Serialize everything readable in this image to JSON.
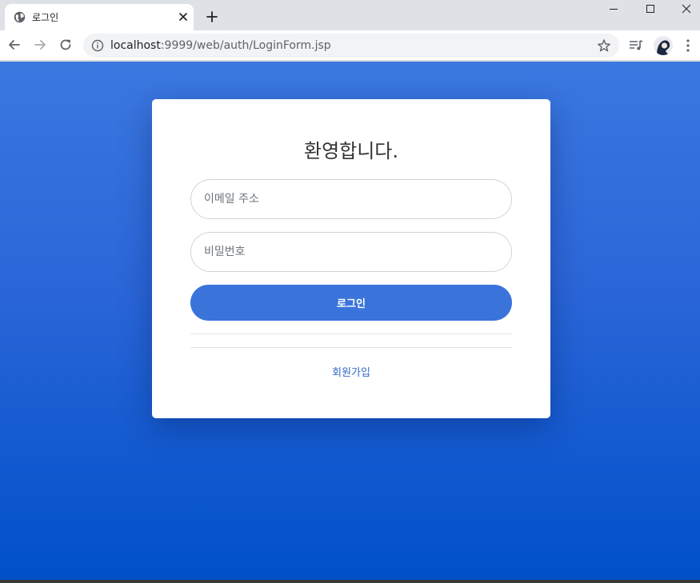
{
  "browser": {
    "tab_title": "로그인",
    "url_host": "localhost",
    "url_rest": ":9999/web/auth/LoginForm.jsp"
  },
  "login": {
    "heading": "환영합니다.",
    "email_placeholder": "이메일 주소",
    "password_placeholder": "비밀번호",
    "submit_label": "로그인",
    "signup_label": "회원가입"
  },
  "colors": {
    "accent": "#3a74db",
    "link": "#3467c6",
    "background_top": "#3b78e0",
    "background_bottom": "#0050c9"
  },
  "icons": [
    "globe-icon",
    "close-icon",
    "plus-icon",
    "minimize-icon",
    "maximize-icon",
    "window-close-icon",
    "back-arrow-icon",
    "forward-arrow-icon",
    "reload-icon",
    "info-icon",
    "star-icon",
    "media-control-icon",
    "avatar",
    "more-vert-icon"
  ]
}
